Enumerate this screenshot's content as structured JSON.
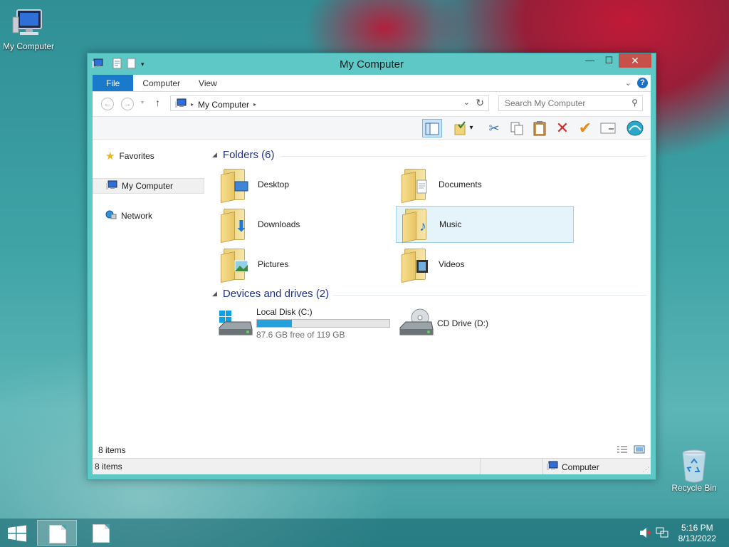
{
  "desktop": {
    "icons": [
      {
        "label": "My Computer",
        "icon": "computer-icon"
      },
      {
        "label": "Recycle Bin",
        "icon": "recycle-bin-icon"
      }
    ]
  },
  "window": {
    "title": "My Computer",
    "buttons": {
      "minimize": "—",
      "maximize": "☐",
      "close": "✕"
    },
    "ribbon_tabs": [
      "File",
      "Computer",
      "View"
    ],
    "address": {
      "crumb": "My Computer"
    },
    "search": {
      "placeholder": "Search My Computer"
    },
    "sidebar": [
      {
        "label": "Favorites",
        "icon": "star-icon"
      },
      {
        "label": "My Computer",
        "icon": "computer-icon"
      },
      {
        "label": "Network",
        "icon": "network-icon"
      }
    ],
    "groups": {
      "folders": {
        "title": "Folders (6)",
        "items": [
          "Desktop",
          "Documents",
          "Downloads",
          "Music",
          "Pictures",
          "Videos"
        ]
      },
      "drives": {
        "title": "Devices and drives (2)",
        "items": [
          {
            "label": "Local Disk (C:)",
            "free_text": "87.6 GB free of 119 GB",
            "used_fraction": 0.264
          },
          {
            "label": "CD Drive (D:)"
          }
        ]
      }
    },
    "status_inner": "8 items",
    "status_bar": {
      "left": "8 items",
      "right": "Computer"
    }
  },
  "taskbar": {
    "time": "5:16 PM",
    "date": "8/13/2022"
  },
  "colors": {
    "accent": "#1979ca",
    "window_frame": "#5ec8c6",
    "close_button": "#c7504b",
    "drive_fill": "#26a0da",
    "group_header": "#1e3287"
  }
}
